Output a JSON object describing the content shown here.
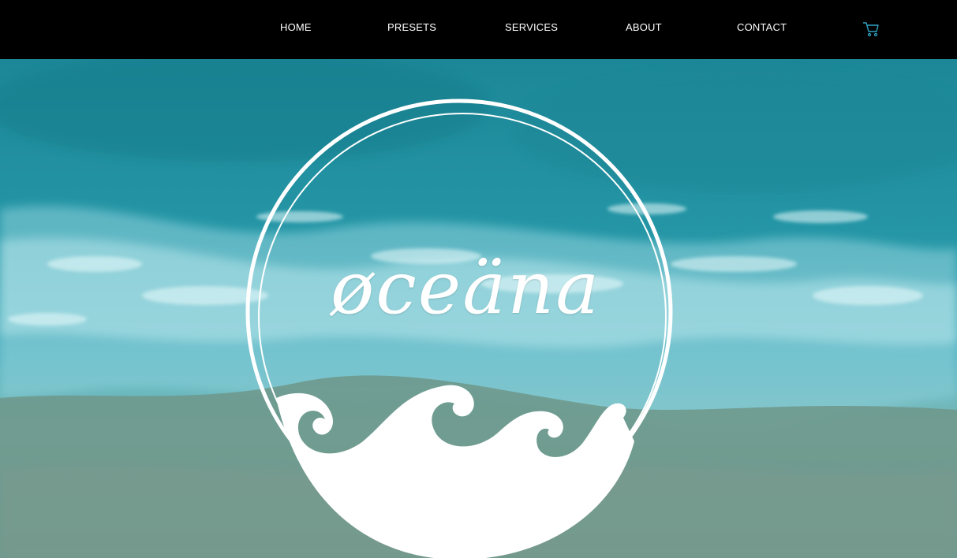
{
  "nav": {
    "items": [
      {
        "label": "HOME"
      },
      {
        "label": "PRESETS"
      },
      {
        "label": "SERVICES"
      },
      {
        "label": "ABOUT"
      },
      {
        "label": "CONTACT"
      }
    ],
    "cart_icon": "shopping-cart-icon"
  },
  "hero": {
    "brand": "øceäna",
    "logo_icon": "wave-circle-logo",
    "colors": {
      "ocean_deep": "#1f8a9a",
      "ocean_mid": "#3aa5b5",
      "surf": "#8ed2dc",
      "sand": "#6f9a8e",
      "cart_accent": "#2fa3c2"
    }
  }
}
